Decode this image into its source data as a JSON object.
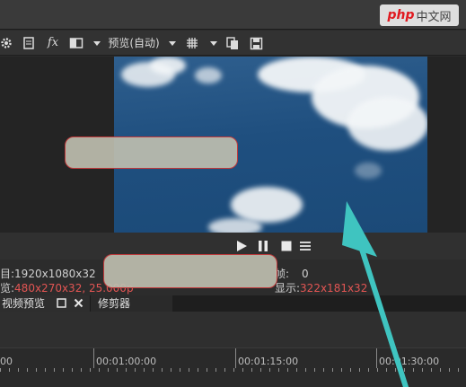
{
  "watermark": {
    "brand": "php",
    "suffix": "中文网"
  },
  "toolbar": {
    "preview_label": "预览(自动)",
    "fx_label": "fx"
  },
  "info": {
    "project_label": "项目:",
    "project_value": "1920x1080x32",
    "preview_label": "预览:",
    "preview_value": "480x270x32, 25.000p",
    "frame_label": "帧:",
    "frame_value": "0",
    "display_label": "显示:",
    "display_value": "322x181x32"
  },
  "tabs": {
    "video_preview": "视频预览",
    "trimmer": "修剪器"
  },
  "timeline": {
    "ticks": [
      "00",
      "00:01:00:00",
      "00:01:15:00",
      "00:01:30:00"
    ]
  },
  "colors": {
    "accent_red": "#e25553",
    "annotation_arrow": "#3fc4c0"
  }
}
